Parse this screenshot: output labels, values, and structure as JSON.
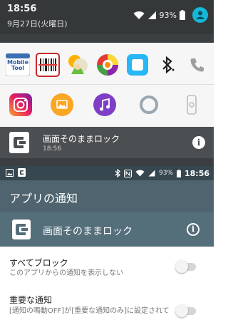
{
  "shade": {
    "time": "18:56",
    "date": "9月27日(火曜日)",
    "battery": "93%",
    "app_row_1": [
      "mobile-tool-icon",
      "barcode-app-icon",
      "weather-app-icon",
      "color-app-icon",
      "watch-app-icon",
      "bluetooth-icon",
      "phone-icon"
    ],
    "app_row_2": [
      "instagram-icon",
      "gallery-icon",
      "music-icon",
      "settings-ring-icon",
      "device-watch-icon"
    ],
    "mobile_tool_line1": "Mobile",
    "mobile_tool_line2": "Tool",
    "notification": {
      "title": "画面そのままロック",
      "time": "18:56"
    }
  },
  "statusbar2": {
    "battery": "93%",
    "time": "18:56"
  },
  "appbar": {
    "title": "アプリの通知"
  },
  "app_header": {
    "name": "画面そのままロック"
  },
  "settings": [
    {
      "title": "すべてブロック",
      "desc": "このアプリからの通知を表示しない",
      "enabled": false
    },
    {
      "title": "重要な通知",
      "desc": "[通知の鳴動OFF]が[重要な通知のみ]に設定されて",
      "enabled": false
    }
  ],
  "colors": {
    "shade_bg": "#3b3f42",
    "toolbar_bg": "#4f646e",
    "app_header_bg": "#546e7a",
    "accent": "#15b8d8"
  }
}
